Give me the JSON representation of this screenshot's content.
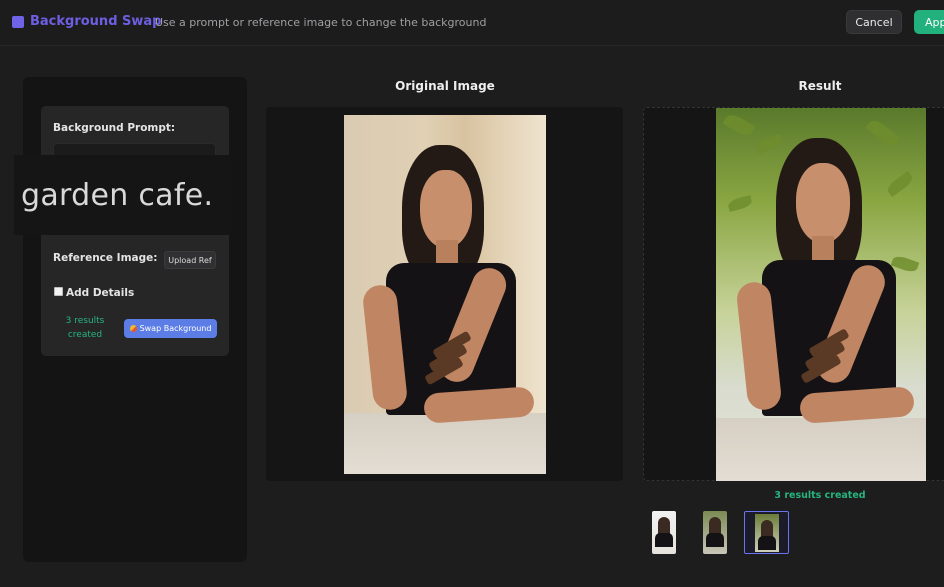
{
  "header": {
    "title": "Background Swap",
    "subtitle": "Use a prompt or reference image to change the background",
    "cancel_label": "Cancel",
    "apply_label": "App"
  },
  "sidebar": {
    "prompt_label": "Background Prompt:",
    "prompt_zoom_text": "garden cafe.",
    "reference_label": "Reference Image:",
    "upload_label": "Upload Ref",
    "add_details_label": "Add Details",
    "add_details_checked": false,
    "results_line1": "3 results",
    "results_line2": "created",
    "swap_label": "Swap Background"
  },
  "main": {
    "original_title": "Original Image",
    "result_title": "Result",
    "results_caption": "3 results created",
    "selected_thumb": 3
  },
  "colors": {
    "brand": "#6d5fe3",
    "apply": "#22b07d",
    "success_text": "#27b47f",
    "swap_button": "#5c7de6"
  }
}
